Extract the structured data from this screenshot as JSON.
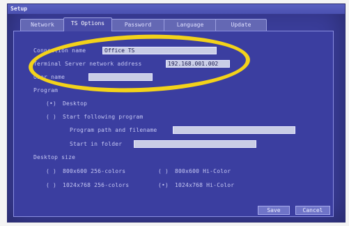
{
  "window": {
    "title": "Setup"
  },
  "tabs": [
    {
      "label": "Network"
    },
    {
      "label": "TS Options"
    },
    {
      "label": "Password"
    },
    {
      "label": "Language"
    },
    {
      "label": "Update"
    }
  ],
  "fields": {
    "connection_name": {
      "label": "Connection name",
      "value": "Office TS"
    },
    "ts_address": {
      "label": "Terminal Server network address",
      "value": "192.168.001.002"
    },
    "user_name": {
      "label": "User name",
      "value": ""
    }
  },
  "program": {
    "heading": "Program",
    "desktop": {
      "marker": "(•)",
      "label": "Desktop"
    },
    "start_following": {
      "marker": "( )",
      "label": "Start following program"
    },
    "path_label": "Program path and filename",
    "path_value": "",
    "folder_label": "Start in folder",
    "folder_value": ""
  },
  "desktop_size": {
    "heading": "Desktop size",
    "opt1": {
      "marker": "( )",
      "label": "800x600 256-colors"
    },
    "opt2": {
      "marker": "( )",
      "label": "800x600 Hi-Color"
    },
    "opt3": {
      "marker": "( )",
      "label": "1024x768 256-colors"
    },
    "opt4": {
      "marker": "(•)",
      "label": "1024x768 Hi-Color"
    }
  },
  "buttons": {
    "save": "Save",
    "cancel": "Cancel"
  },
  "colors": {
    "highlight_ellipse": "#f3d21a",
    "panel": "#3b3ea0"
  }
}
